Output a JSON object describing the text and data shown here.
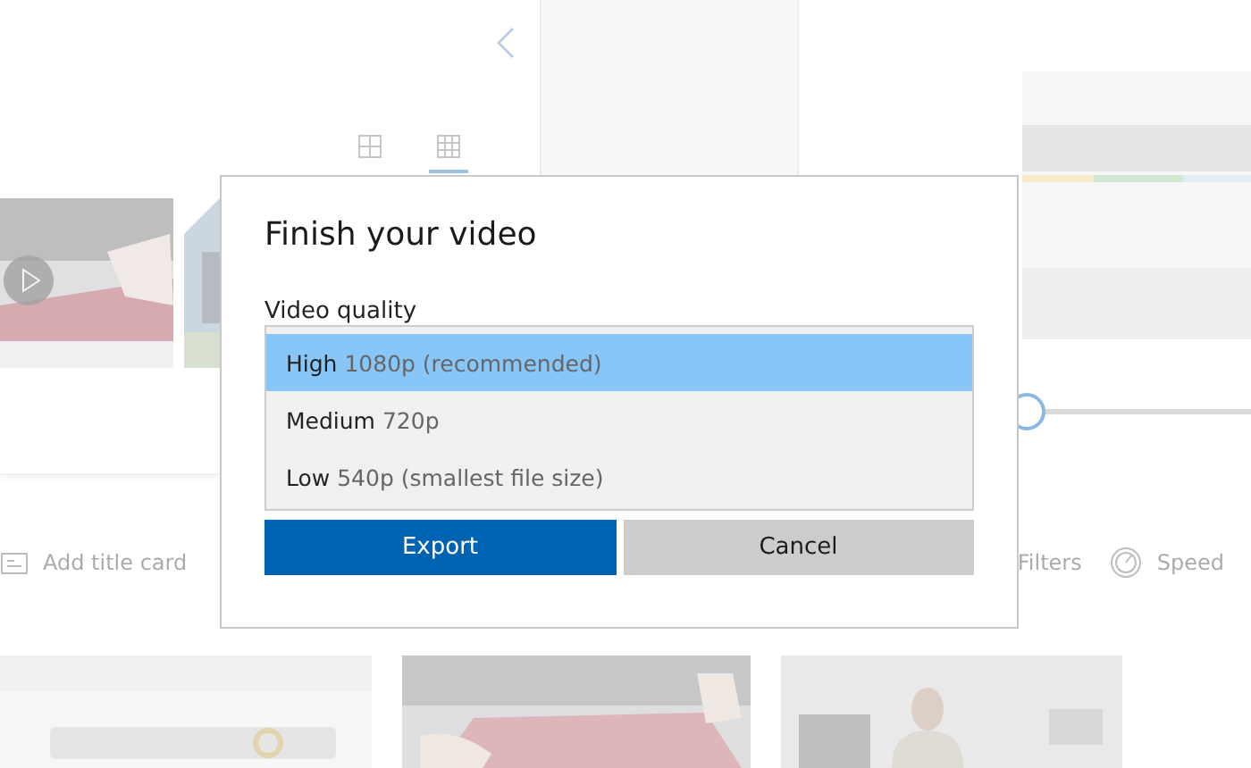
{
  "library": {
    "view_options": [
      {
        "kind": "large-grid",
        "selected": false
      },
      {
        "kind": "small-grid",
        "selected": true
      }
    ]
  },
  "preview": {
    "scrubber": {
      "level": 0.49
    }
  },
  "toolbar": [
    {
      "kind": "title-card",
      "label": "Add title card"
    },
    {
      "kind": "filters",
      "label": "Filters"
    },
    {
      "kind": "speed",
      "label": "Speed"
    }
  ],
  "dialog": {
    "title": "Finish your video",
    "field_label": "Video quality",
    "options": [
      {
        "name": "High",
        "detail": "1080p (recommended)",
        "selected": true
      },
      {
        "name": "Medium",
        "detail": "720p",
        "selected": false
      },
      {
        "name": "Low",
        "detail": "540p (smallest file size)",
        "selected": false
      }
    ],
    "buttons": [
      {
        "label": "Export",
        "kind": "primary"
      },
      {
        "label": "Cancel",
        "kind": "secondary"
      }
    ]
  }
}
